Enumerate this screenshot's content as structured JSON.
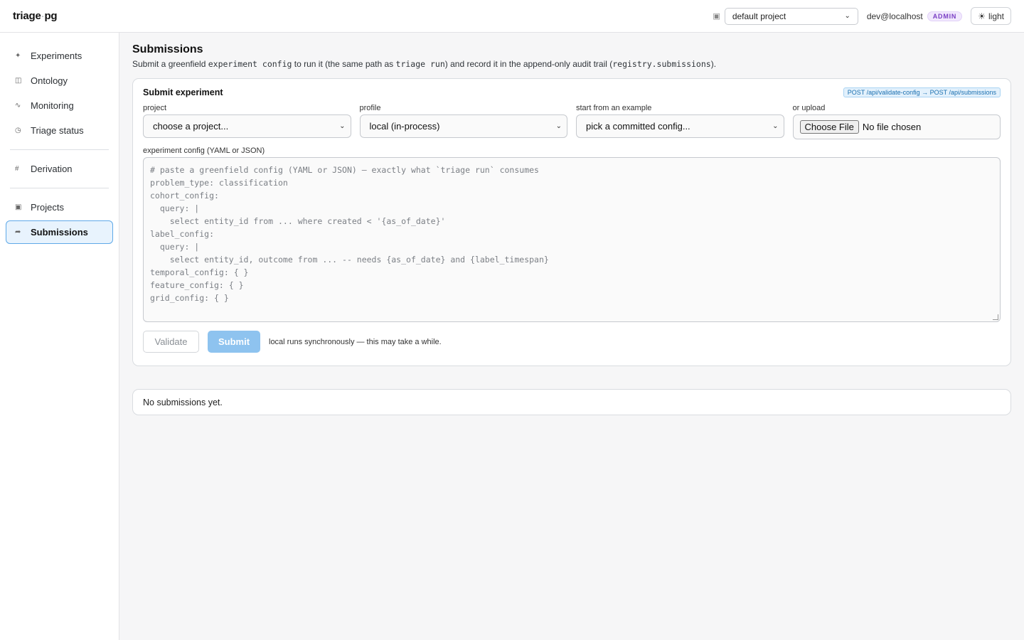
{
  "app": {
    "brand_main": "triage",
    "brand_dot": "·",
    "brand_suffix": "pg"
  },
  "header": {
    "project_select_value": "default project",
    "user": "dev@localhost",
    "role_badge": "ADMIN",
    "theme_label": "light"
  },
  "sidebar": {
    "items": [
      {
        "label": "Experiments",
        "icon": "sparkle-icon",
        "glyph": "✦"
      },
      {
        "label": "Ontology",
        "icon": "ontology-icon",
        "glyph": "◫"
      },
      {
        "label": "Monitoring",
        "icon": "monitoring-icon",
        "glyph": "∿"
      },
      {
        "label": "Triage status",
        "icon": "status-icon",
        "glyph": "◷"
      },
      {
        "label": "Derivation",
        "icon": "derivation-icon",
        "glyph": "#"
      },
      {
        "label": "Projects",
        "icon": "projects-icon",
        "glyph": "▣"
      },
      {
        "label": "Submissions",
        "icon": "submissions-icon",
        "glyph": "➦"
      }
    ],
    "active": "Submissions"
  },
  "page": {
    "title": "Submissions",
    "desc_1": "Submit a greenfield ",
    "desc_code_1": "experiment config",
    "desc_2": " to run it (the same path as ",
    "desc_code_2": "triage run",
    "desc_3": ") and record it in the append-only audit trail (",
    "desc_code_3": "registry.submissions",
    "desc_4": ")."
  },
  "form": {
    "title": "Submit experiment",
    "endpoint_badge": "POST /api/validate-config → POST /api/submissions",
    "project_label": "project",
    "project_value": "choose a project...",
    "profile_label": "profile",
    "profile_value": "local (in-process)",
    "example_label": "start from an example",
    "example_value": "pick a committed config...",
    "upload_label": "or upload",
    "choose_file": "Choose File",
    "no_file": "No file chosen",
    "config_label": "experiment config (YAML or JSON)",
    "config_placeholder": "# paste a greenfield config (YAML or JSON) — exactly what `triage run` consumes\nproblem_type: classification\ncohort_config:\n  query: |\n    select entity_id from ... where created < '{as_of_date}'\nlabel_config:\n  query: |\n    select entity_id, outcome from ... -- needs {as_of_date} and {label_timespan}\ntemporal_config: { }\nfeature_config: { }\ngrid_config: { }",
    "validate_label": "Validate",
    "submit_label": "Submit",
    "hint": "local runs synchronously — this may take a while."
  },
  "submissions": {
    "empty_text": "No submissions yet."
  }
}
